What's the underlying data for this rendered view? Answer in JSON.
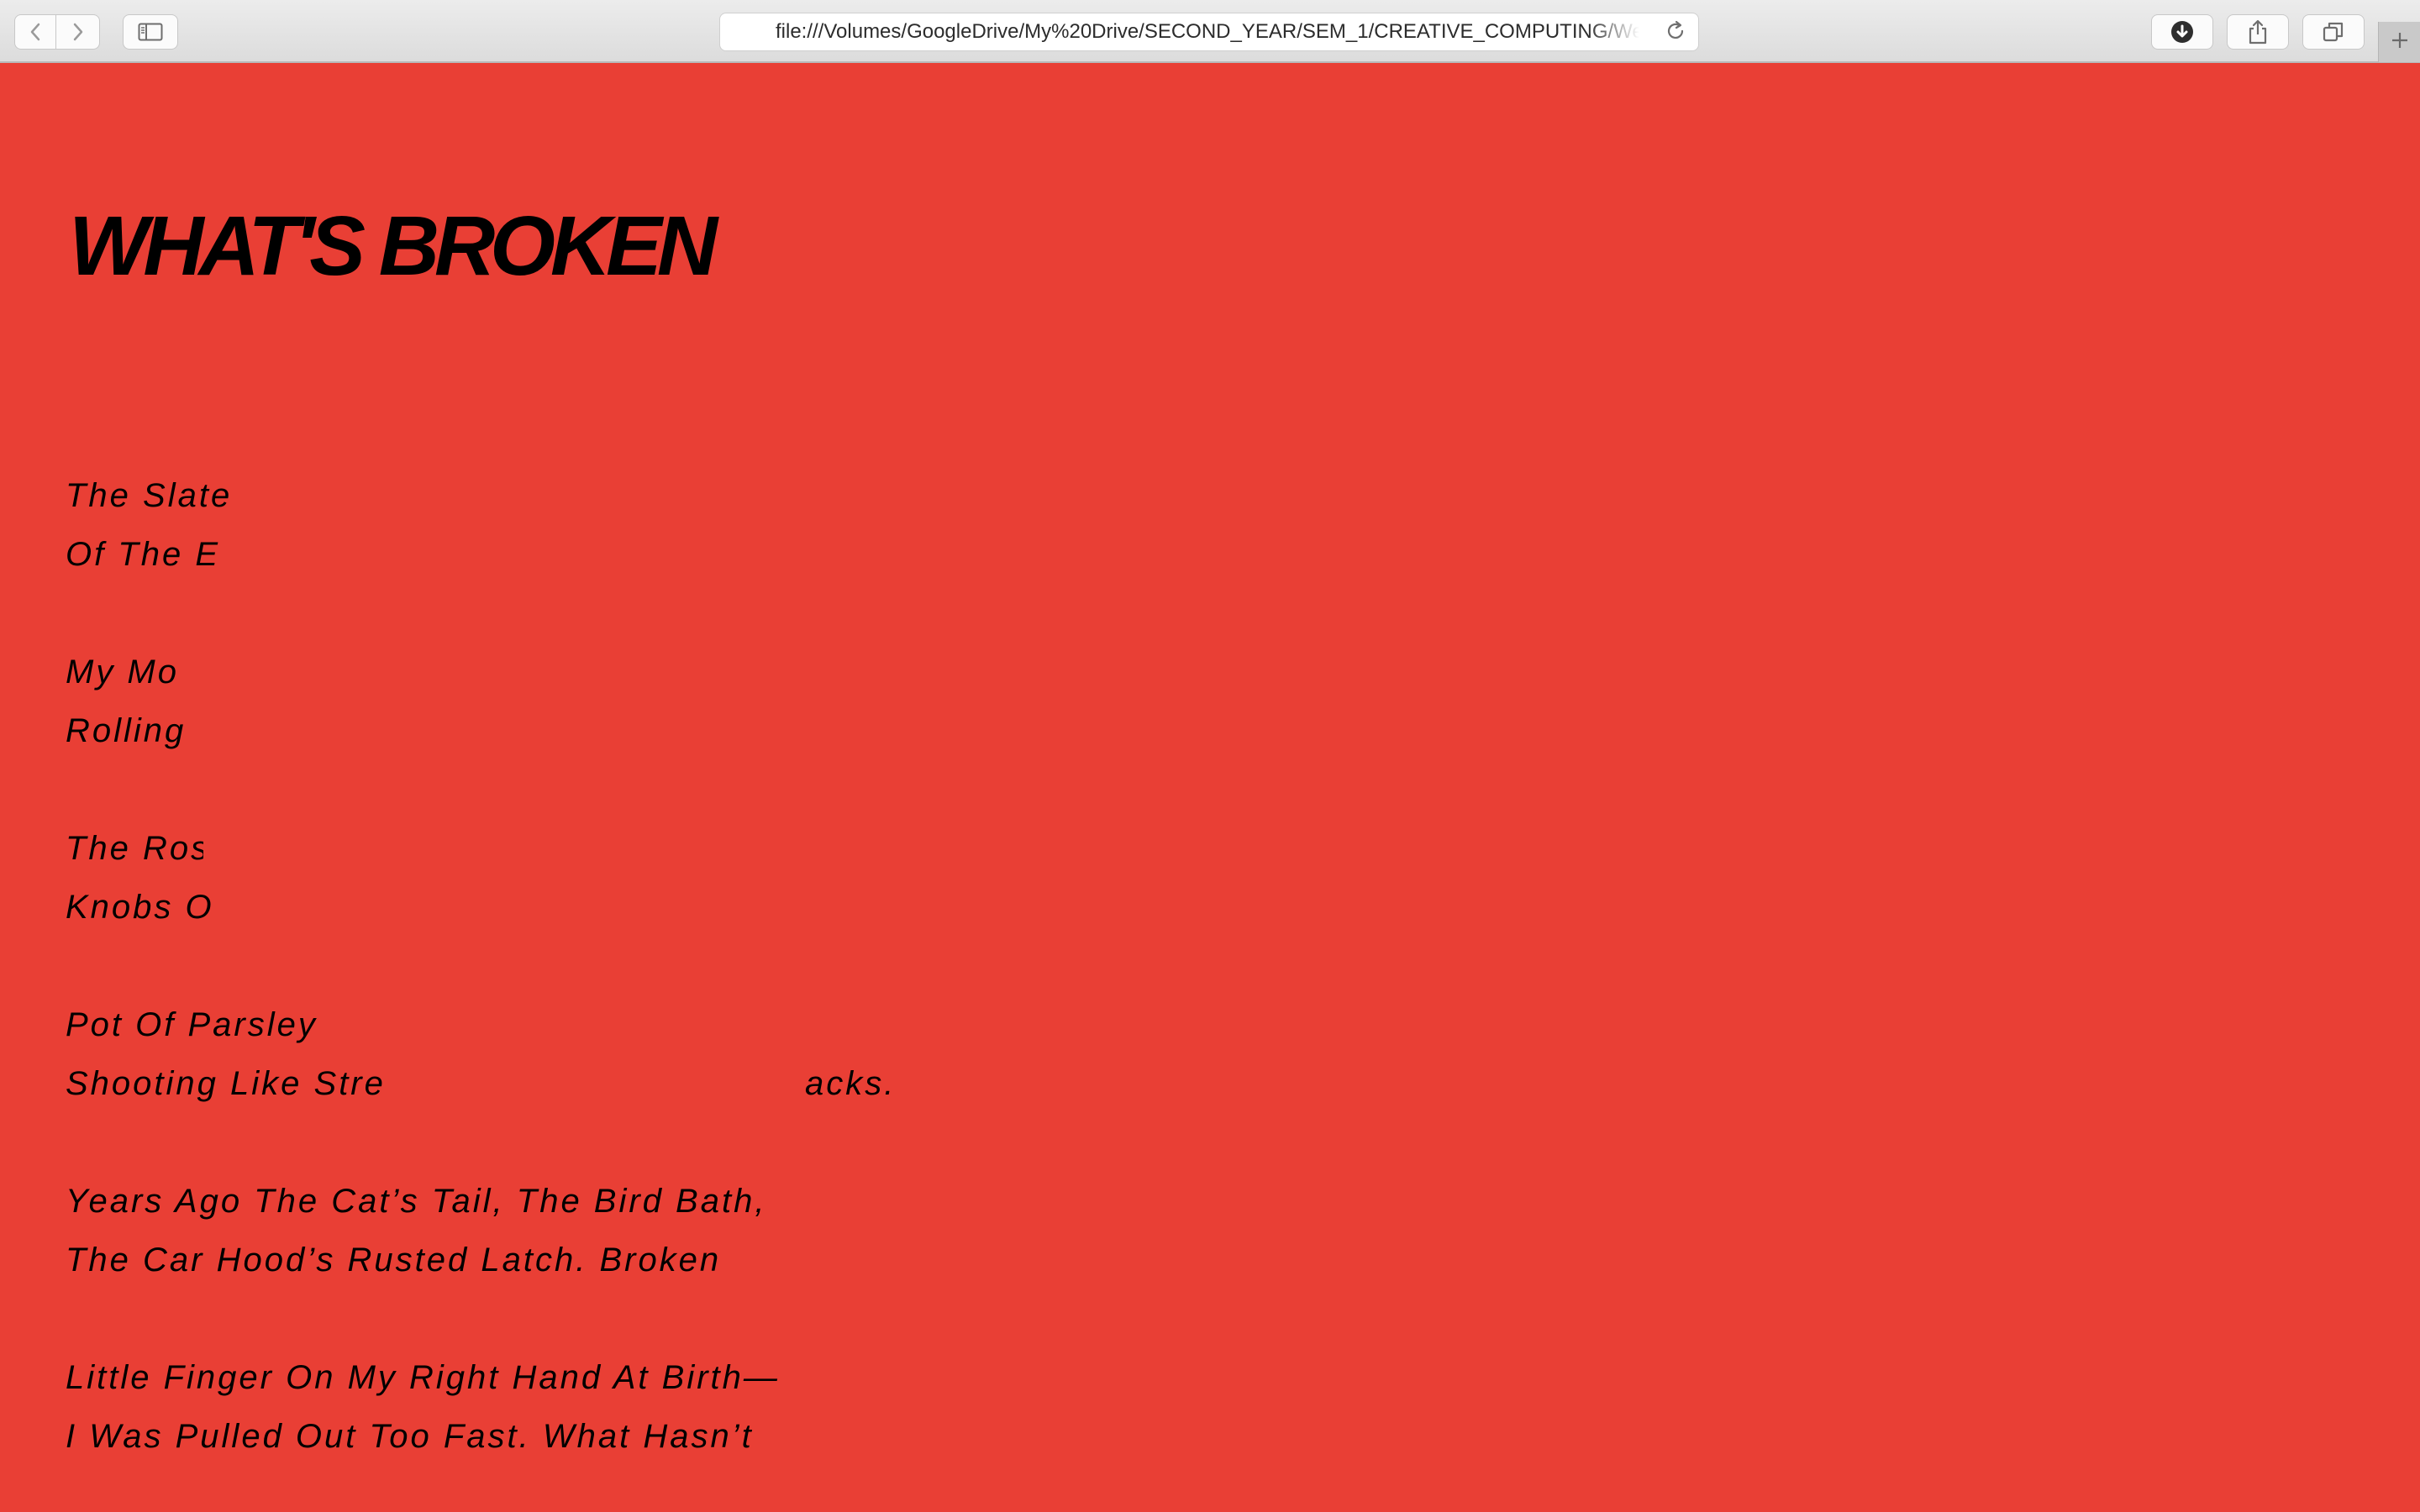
{
  "browser": {
    "url": "file:///Volumes/GoogleDrive/My%20Drive/SECOND_YEAR/SEM_1/CREATIVE_COMPUTING/We",
    "icons": {
      "back": "chevron-left-icon",
      "forward": "chevron-right-icon",
      "sidebar": "sidebar-icon",
      "reload": "reload-icon",
      "download": "download-icon",
      "share": "share-icon",
      "tabs": "tabs-icon",
      "new_tab": "plus-icon"
    }
  },
  "page": {
    "background": "#e93f35",
    "title": "WHAT'S BROKEN",
    "lines": [
      "The Slate",
      "Of The E",
      "My Mo",
      "Rolling",
      "The Ros",
      "Knobs O",
      "Pot Of Parsley",
      "Shooting Like Stre",
      "acks.",
      "Years Ago The Cat’s Tail, The Bird Bath,",
      "The Car Hood’s Rusted Latch. Broken",
      "Little Finger On My Right Hand At Birth—",
      "I Was Pulled Out Too Fast. What Hasn’t"
    ]
  }
}
